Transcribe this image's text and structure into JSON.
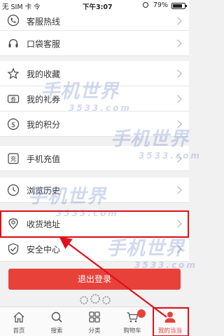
{
  "status_bar": {
    "carrier": "无 SIM 卡 令",
    "time": "下午3:07",
    "battery_text": "79%",
    "battery_level": 0.79
  },
  "menu": {
    "hotline": "客服热线",
    "pocket_service": "口袋客服",
    "favorites": "我的收藏",
    "coupons": "我的礼券",
    "points": "我的积分",
    "recharge": "手机充值",
    "history": "浏览历史",
    "address": "收货地址",
    "security": "安全中心"
  },
  "logout_label": "退出登录",
  "watermark": {
    "text": "手机世界",
    "number": "3533.com"
  },
  "tabs": [
    {
      "label": "首页",
      "icon": "home-icon"
    },
    {
      "label": "搜索",
      "icon": "search-icon"
    },
    {
      "label": "分类",
      "icon": "category-icon"
    },
    {
      "label": "购物车",
      "icon": "cart-icon"
    },
    {
      "label": "我的当当",
      "icon": "user-icon"
    }
  ],
  "colors": {
    "accent": "#e8413a",
    "highlight": "#e0101a"
  }
}
